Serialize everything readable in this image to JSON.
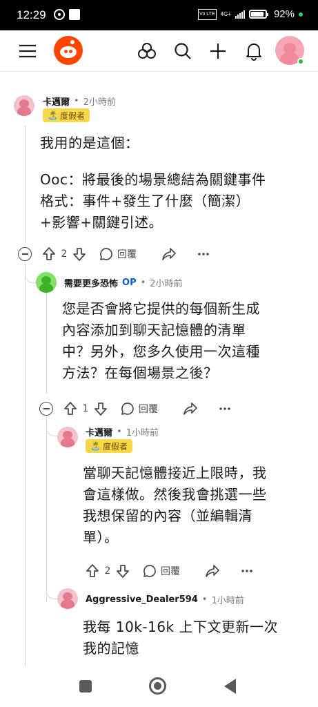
{
  "status_bar": {
    "time": "12:29",
    "network": "4G+",
    "volte": "Vo LTE",
    "battery": "92%"
  },
  "top_nav": {
    "icons": [
      "menu-icon",
      "reddit-logo-icon",
      "communities-icon",
      "search-icon",
      "plus-icon",
      "bell-icon",
      "user-avatar"
    ]
  },
  "comments": [
    {
      "author": "卡邁爾",
      "time": "2小時前",
      "flair": "度假者",
      "flair_emoji": "🏝️",
      "body": [
        "我用的是這個：",
        "Ooc：將最後的場景總結為關鍵事件\n格式：事件+發生了什麼（簡潔）\n+影響+關鍵引述。"
      ],
      "votes": "2",
      "reply_label": "回覆"
    },
    {
      "author": "需要更多恐怖",
      "op_label": "OP",
      "time": "2小時前",
      "body": [
        "您是否會將它提供的每個新生成\n內容添加到聊天記憶體的清單\n中？另外，您多久使用一次這種\n方法？在每個場景之後？"
      ],
      "votes": "1",
      "reply_label": "回覆"
    },
    {
      "author": "卡邁爾",
      "time": "1小時前",
      "flair": "度假者",
      "flair_emoji": "🏝️",
      "body": [
        "當聊天記憶體接近上限時，我\n會這樣做。然後我會挑選一些\n我想保留的內容（並編輯清\n單）。"
      ],
      "votes": "2",
      "reply_label": "回覆"
    },
    {
      "author": "Aggressive_Dealer594",
      "time": "1小時前",
      "body": [
        "我每 10k-16k 上下文更新一次\n我的記憶"
      ]
    }
  ],
  "separator": "•",
  "colors": {
    "brand": "#ff4500",
    "flair_bg": "#f8d848",
    "op": "#0a5bd6"
  }
}
